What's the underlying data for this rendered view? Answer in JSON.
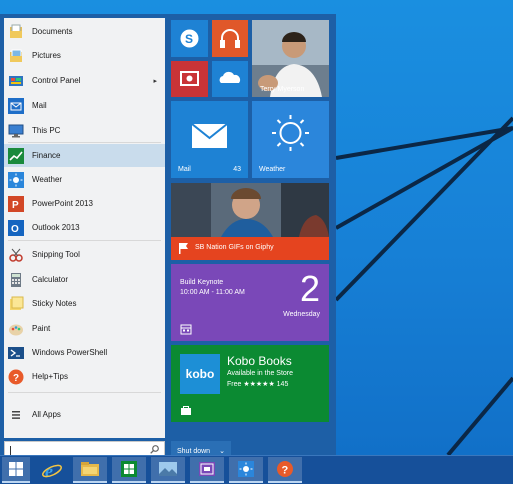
{
  "start_menu": {
    "left_apps": [
      {
        "label": "Documents",
        "icon": "documents-folder-icon"
      },
      {
        "label": "Pictures",
        "icon": "pictures-folder-icon"
      },
      {
        "label": "Control Panel",
        "icon": "control-panel-icon",
        "arrow": "▸"
      },
      {
        "label": "Mail",
        "icon": "mail-icon"
      },
      {
        "label": "This PC",
        "icon": "this-pc-icon"
      },
      {
        "label": "Finance",
        "icon": "finance-icon"
      },
      {
        "label": "Weather",
        "icon": "weather-icon"
      },
      {
        "label": "PowerPoint 2013",
        "icon": "powerpoint-icon"
      },
      {
        "label": "Outlook 2013",
        "icon": "outlook-icon"
      },
      {
        "label": "Snipping Tool",
        "icon": "snipping-tool-icon"
      },
      {
        "label": "Calculator",
        "icon": "calculator-icon"
      },
      {
        "label": "Sticky Notes",
        "icon": "sticky-notes-icon"
      },
      {
        "label": "Paint",
        "icon": "paint-icon"
      },
      {
        "label": "Windows PowerShell",
        "icon": "powershell-icon"
      },
      {
        "label": "Help+Tips",
        "icon": "help-tips-icon"
      }
    ],
    "all_apps_label": "All Apps",
    "search_placeholder": "",
    "shutdown_label": "Shut down",
    "shutdown_chevron": "⌄"
  },
  "tiles": {
    "person_name": "Terry Myerson",
    "mail_label": "Mail",
    "mail_count": "43",
    "weather_label": "Weather",
    "giphy_caption": "SB Nation GIFs on Giphy",
    "calendar": {
      "event": "Build Keynote",
      "time": "10:00 AM - 11:00 AM",
      "day_number": "2",
      "day_name": "Wednesday"
    },
    "kobo": {
      "logo": "kobo",
      "title": "Kobo Books",
      "subtitle": "Available in the Store",
      "rating": "Free ★★★★★ 145"
    }
  },
  "taskbar": {
    "items": [
      "windows-start-icon",
      "internet-explorer-icon",
      "file-explorer-icon",
      "store-icon",
      "photos-icon",
      "video-icon",
      "weather-icon",
      "help-icon"
    ]
  },
  "colors": {
    "desktop": "#1780d6",
    "start_background": "#1d5fa6",
    "taskbar": "#16509a",
    "tile_blue": "#1e82d4",
    "tile_orange": "#e0582a",
    "tile_red": "#c93437",
    "tile_purple": "#7a48b8",
    "tile_green": "#0b8a32",
    "selected_row": "#c9dcec"
  }
}
